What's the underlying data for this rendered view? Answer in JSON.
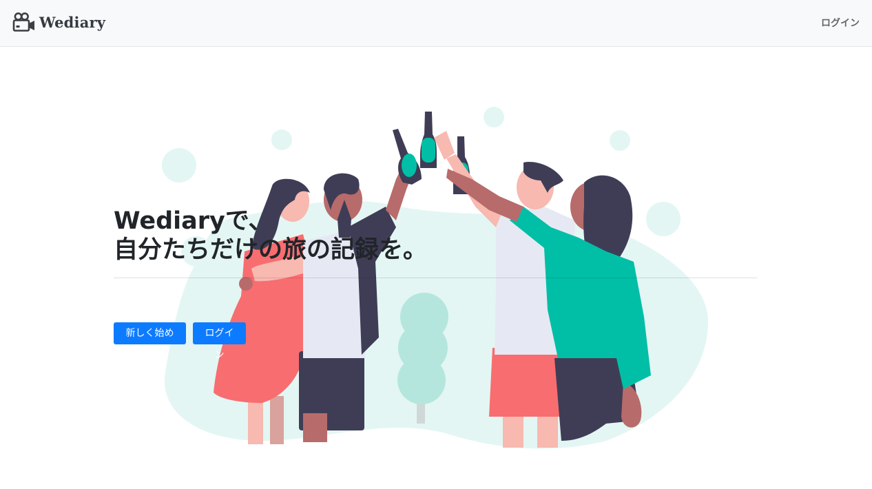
{
  "header": {
    "brand_icon": "video-camera-icon",
    "brand_name": "Wediary",
    "login_link": "ログイン"
  },
  "hero": {
    "title_line1": "Wediaryで、",
    "title_line2": "自分たちだけの旅の記録を。",
    "illustration": "friends-toasting-illustration",
    "primary_button": "新しく始める",
    "secondary_button": "ログイン"
  },
  "colors": {
    "navbar_bg": "#f8f9fa",
    "button_bg": "#0d7bff",
    "accent_teal": "#00bfa6",
    "accent_coral": "#f86d70",
    "dark_navy": "#3f3d56",
    "blob_mint": "#e3f6f3"
  }
}
